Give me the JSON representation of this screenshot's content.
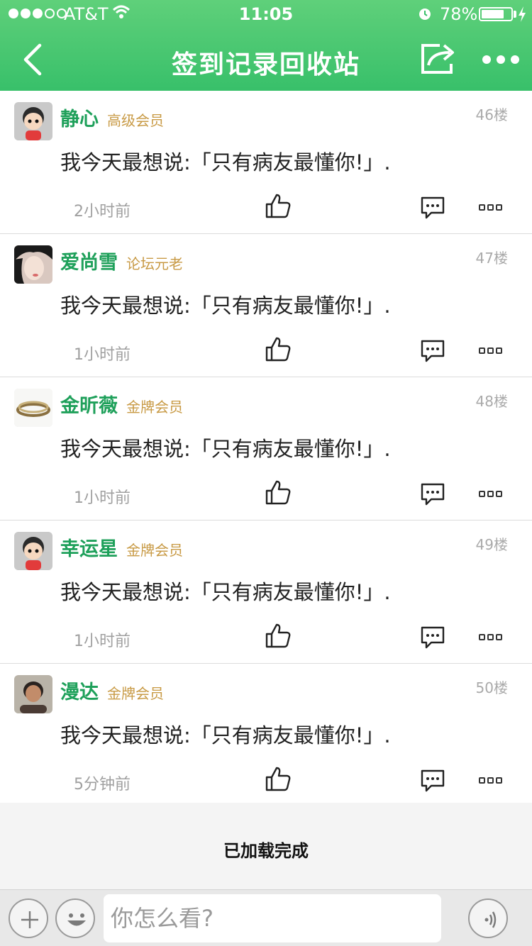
{
  "status_bar": {
    "carrier": "AT&T",
    "time": "11:05",
    "battery_percent_text": "78%",
    "battery_level": 0.78,
    "signal_bars_filled": 3,
    "signal_bars_total": 5
  },
  "nav": {
    "title": "签到记录回收站",
    "back_icon": "chevron-left-icon",
    "share_icon": "share-icon",
    "more_icon": "more-dots-icon"
  },
  "posts": [
    {
      "username": "静心",
      "level": "高级会员",
      "floor": "46楼",
      "content": "我今天最想说:「只有病友最懂你!」.",
      "time": "2小时前",
      "avatar": "cartoon-boy-avatar"
    },
    {
      "username": "爱尚雪",
      "level": "论坛元老",
      "floor": "47楼",
      "content": "我今天最想说:「只有病友最懂你!」.",
      "time": "1小时前",
      "avatar": "woman-photo-avatar"
    },
    {
      "username": "金昕薇",
      "level": "金牌会员",
      "floor": "48楼",
      "content": "我今天最想说:「只有病友最懂你!」.",
      "time": "1小时前",
      "avatar": "rings-photo-avatar"
    },
    {
      "username": "幸运星",
      "level": "金牌会员",
      "floor": "49楼",
      "content": "我今天最想说:「只有病友最懂你!」.",
      "time": "1小时前",
      "avatar": "cartoon-boy-avatar"
    },
    {
      "username": "漫达",
      "level": "金牌会员",
      "floor": "50楼",
      "content": "我今天最想说:「只有病友最懂你!」.",
      "time": "5分钟前",
      "avatar": "woman-portrait-avatar"
    }
  ],
  "footer": {
    "loaded_text": "已加载完成"
  },
  "input_bar": {
    "placeholder": "你怎么看?"
  },
  "colors": {
    "header_green": "#38c06a",
    "username_green": "#1ea05a",
    "level_gold": "#c89a45"
  }
}
